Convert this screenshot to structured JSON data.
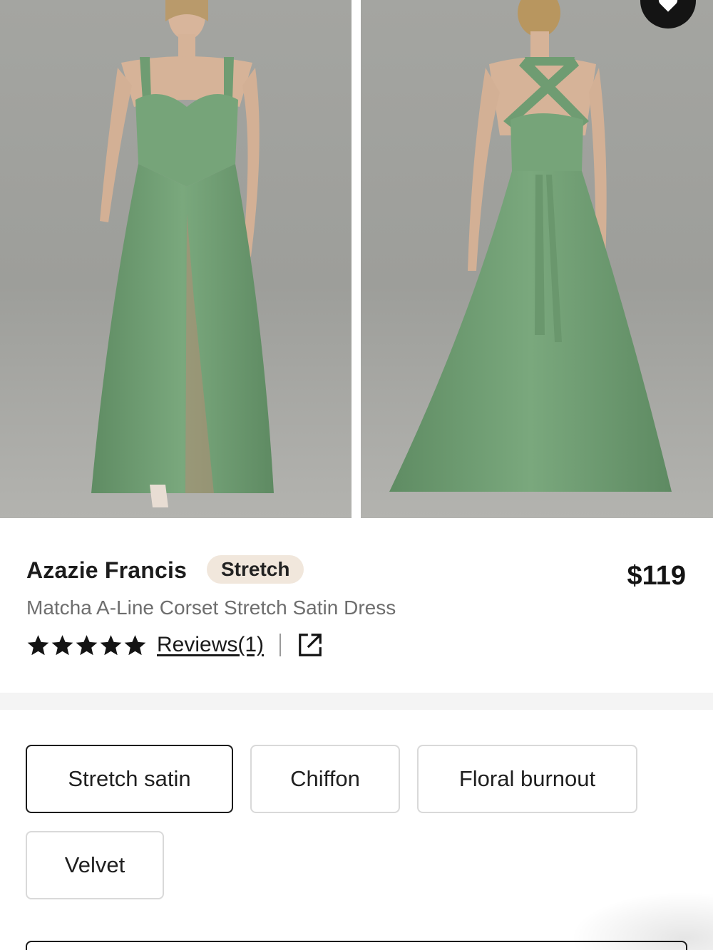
{
  "product": {
    "brand": "Azazie Francis",
    "tag": "Stretch",
    "price": "$119",
    "subtitle": "Matcha A-Line Corset Stretch Satin Dress",
    "rating": {
      "stars": 5,
      "max": 5
    },
    "reviews_label": "Reviews(1)"
  },
  "fabrics": {
    "options": [
      "Stretch satin",
      "Chiffon",
      "Floral burnout",
      "Velvet"
    ],
    "selected": "Stretch satin"
  },
  "colors": {
    "dress": "#74a277",
    "background_photo": "#a3a4a0",
    "tag_bg": "#f1e7dc",
    "accent_dark": "#141414"
  },
  "icons": {
    "wishlist": "heart-icon",
    "share": "external-link-icon",
    "star": "star-icon"
  }
}
